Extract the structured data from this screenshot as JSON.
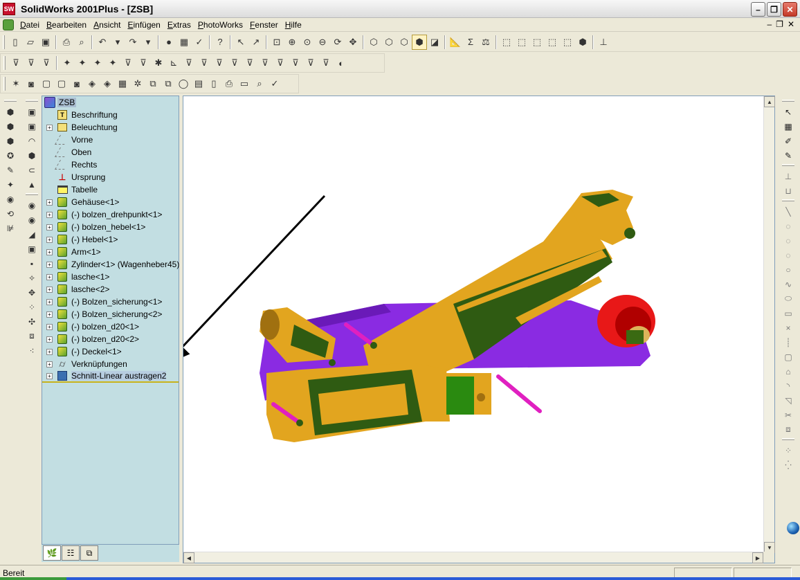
{
  "window": {
    "title": "SolidWorks 2001Plus - [ZSB]",
    "app_icon_label": "SW"
  },
  "menu": [
    "Datei",
    "Bearbeiten",
    "Ansicht",
    "Einfügen",
    "Extras",
    "PhotoWorks",
    "Fenster",
    "Hilfe"
  ],
  "feature_tree": {
    "root": "ZSB",
    "items": [
      {
        "label": "Beschriftung",
        "icon": "annotation-icon",
        "expandable": false
      },
      {
        "label": "Beleuchtung",
        "icon": "lighting-icon",
        "expandable": true
      },
      {
        "label": "Vorne",
        "icon": "plane-icon",
        "expandable": false
      },
      {
        "label": "Oben",
        "icon": "plane-icon",
        "expandable": false
      },
      {
        "label": "Rechts",
        "icon": "plane-icon",
        "expandable": false
      },
      {
        "label": "Ursprung",
        "icon": "origin-icon",
        "expandable": false
      },
      {
        "label": "Tabelle",
        "icon": "table-icon",
        "expandable": false
      },
      {
        "label": "Gehäuse<1>",
        "icon": "part-icon",
        "expandable": true
      },
      {
        "label": "(-) bolzen_drehpunkt<1>",
        "icon": "part-icon",
        "expandable": true
      },
      {
        "label": "(-) bolzen_hebel<1>",
        "icon": "part-icon",
        "expandable": true
      },
      {
        "label": "(-) Hebel<1>",
        "icon": "part-icon",
        "expandable": true
      },
      {
        "label": "Arm<1>",
        "icon": "part-icon",
        "expandable": true
      },
      {
        "label": "Zylinder<1> (Wagenheber45)",
        "icon": "subassembly-icon",
        "expandable": true
      },
      {
        "label": "lasche<1>",
        "icon": "part-icon",
        "expandable": true
      },
      {
        "label": "lasche<2>",
        "icon": "part-icon",
        "expandable": true
      },
      {
        "label": "(-) Bolzen_sicherung<1>",
        "icon": "part-icon",
        "expandable": true
      },
      {
        "label": "(-) Bolzen_sicherung<2>",
        "icon": "part-icon",
        "expandable": true
      },
      {
        "label": "(-) bolzen_d20<1>",
        "icon": "part-icon",
        "expandable": true
      },
      {
        "label": "(-) bolzen_d20<2>",
        "icon": "part-icon",
        "expandable": true
      },
      {
        "label": "(-) Deckel<1>",
        "icon": "part-icon",
        "expandable": true
      },
      {
        "label": "Verknüpfungen",
        "icon": "mates-icon",
        "expandable": true
      },
      {
        "label": "Schnitt-Linear austragen2",
        "icon": "cut-extrude-icon",
        "expandable": true,
        "selected": true
      }
    ]
  },
  "status": {
    "text": "Bereit"
  },
  "colors": {
    "tree_bg": "#c2dee2",
    "housing": "#e2a51f",
    "housing_shadow": "#2f5b12",
    "base": "#8a2be2",
    "pins": "#e020c0",
    "wheel": "#e81818",
    "arrow": "#000000"
  }
}
